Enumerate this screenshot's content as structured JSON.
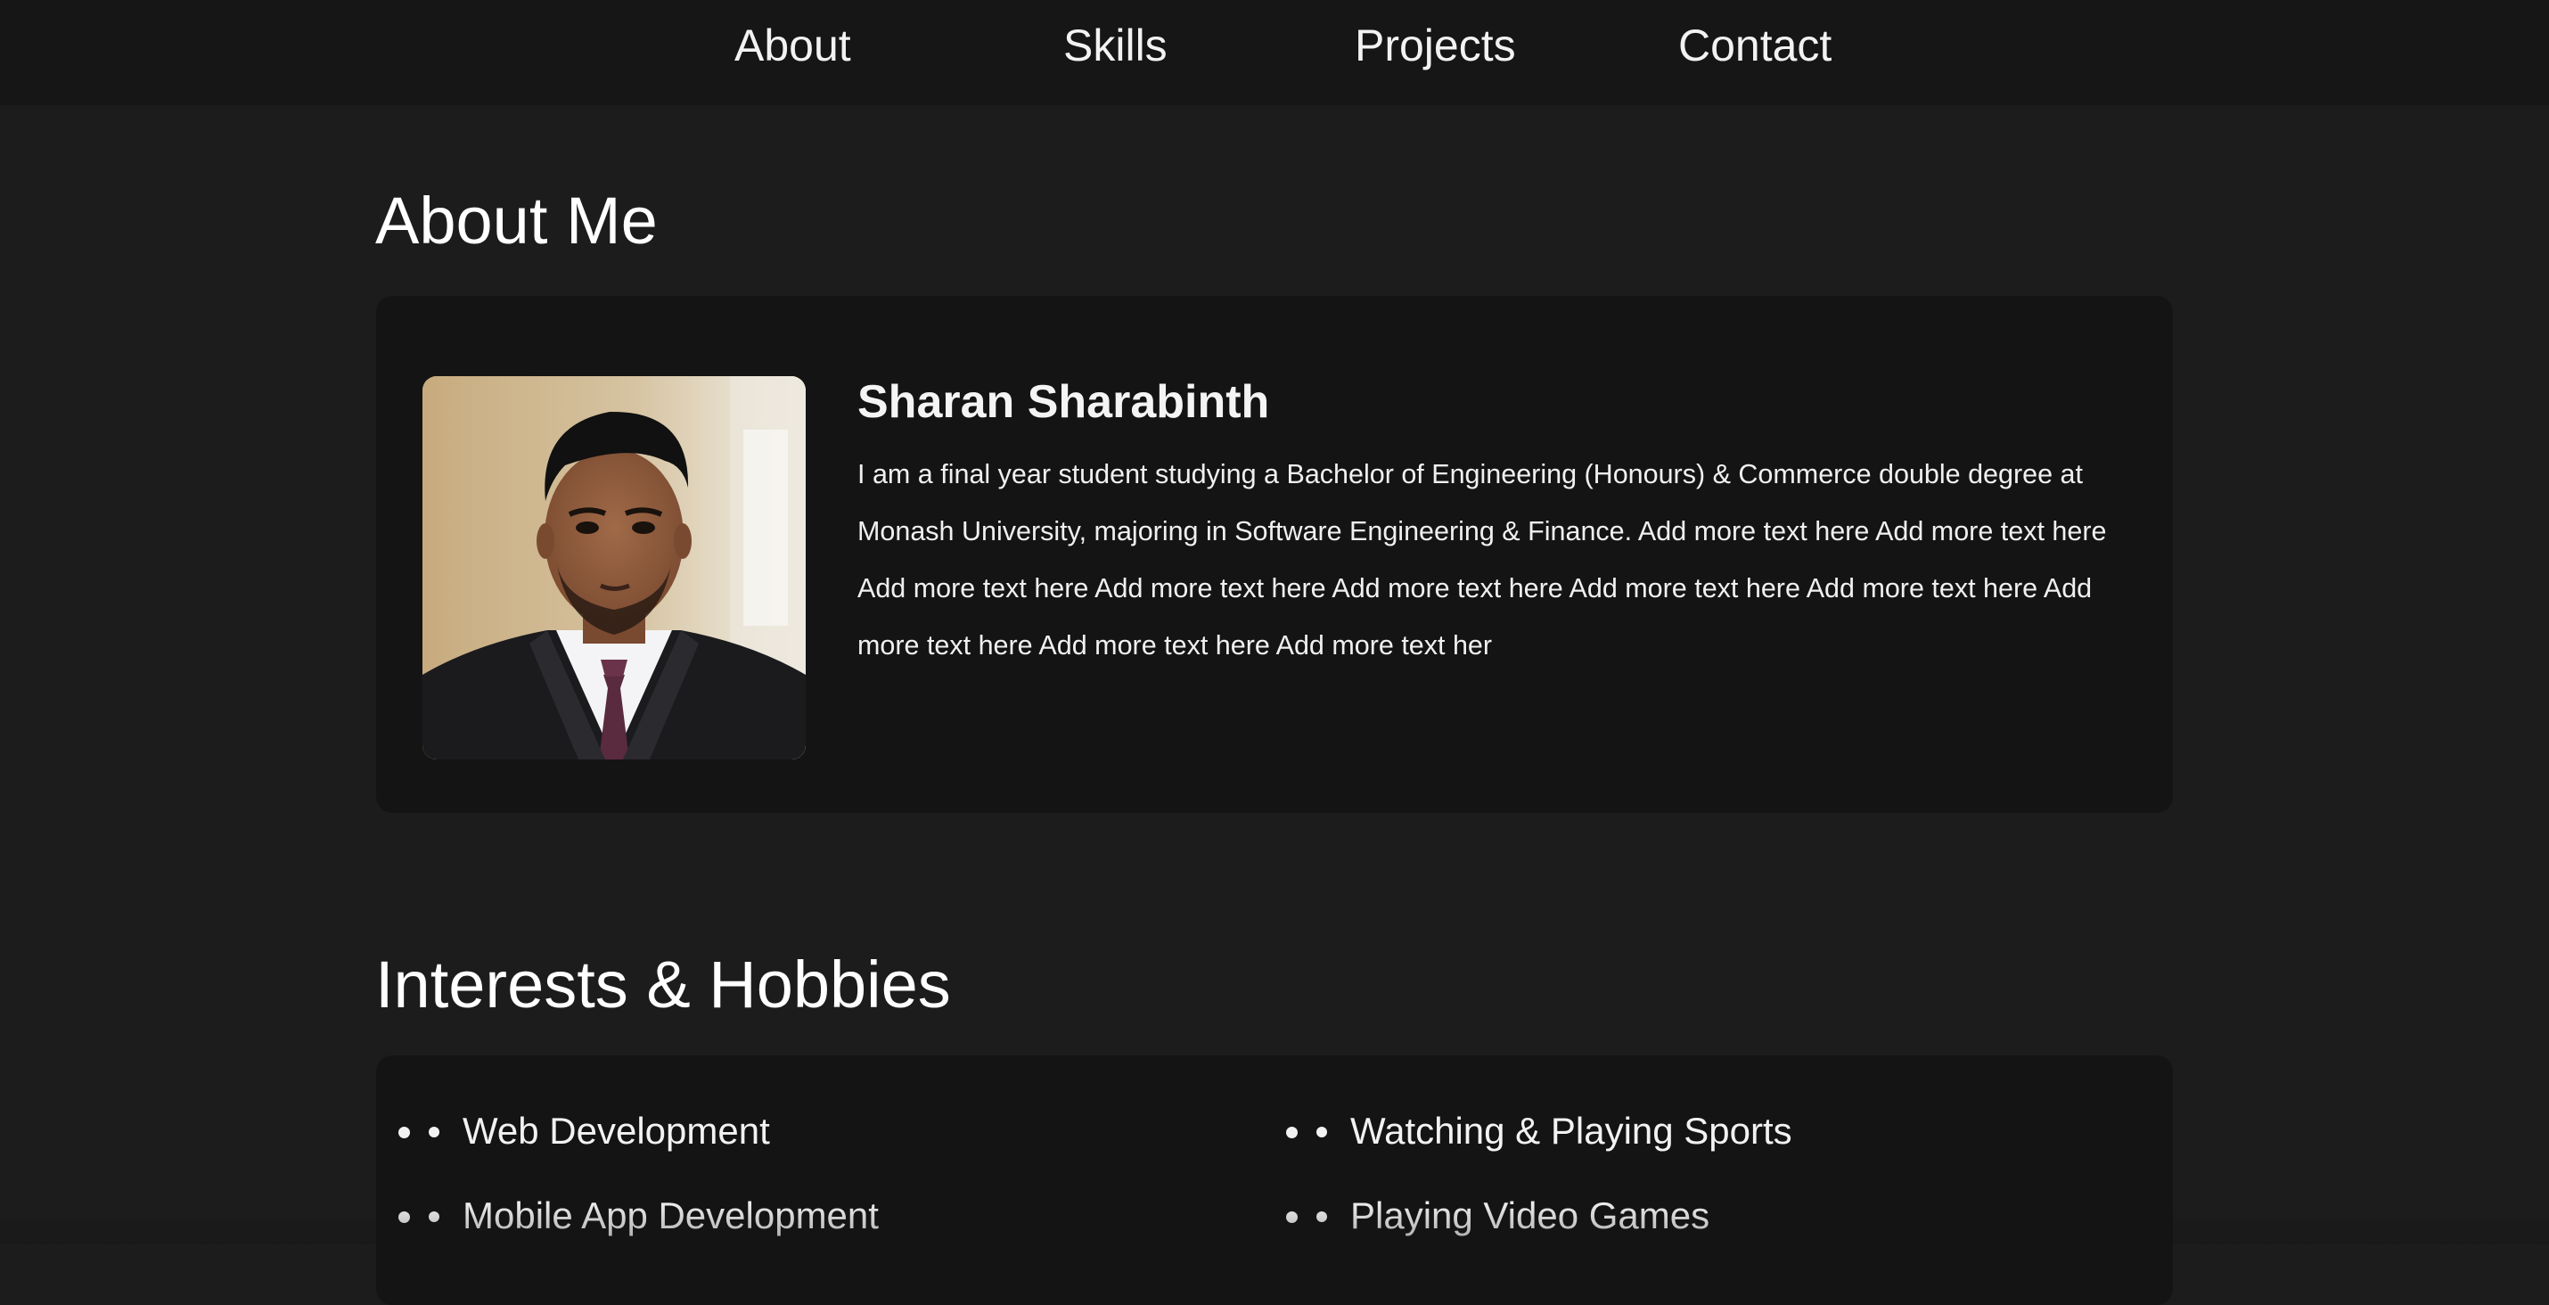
{
  "nav": {
    "items": [
      {
        "label": "About"
      },
      {
        "label": "Skills"
      },
      {
        "label": "Projects"
      },
      {
        "label": "Contact"
      }
    ]
  },
  "about": {
    "title": "About Me",
    "name": "Sharan Sharabinth",
    "bio": "I am a final year student studying a Bachelor of Engineering (Honours) & Commerce double degree at Monash University, majoring in Software Engineering & Finance. Add more text here Add more text here Add more text here Add more text here Add more text here Add more text here Add more text here Add more text here Add more text here Add more text her"
  },
  "interests": {
    "title": "Interests & Hobbies",
    "items": [
      {
        "label": "Web Development"
      },
      {
        "label": "Watching & Playing Sports"
      },
      {
        "label": "Mobile App Development"
      },
      {
        "label": "Playing Video Games"
      }
    ]
  },
  "colors": {
    "page_background": "#1c1c1c",
    "navbar_background": "#161616",
    "card_background": "#141414",
    "text": "#ffffff"
  }
}
